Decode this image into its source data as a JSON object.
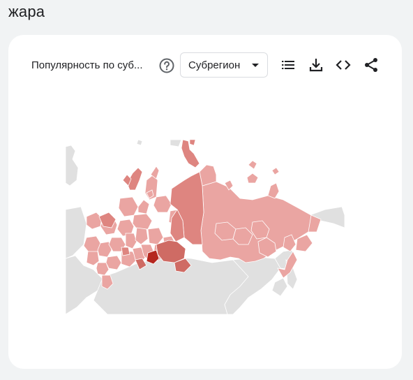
{
  "page": {
    "title": "жара"
  },
  "widget": {
    "title": "Популярность по суб...",
    "resolution_select": {
      "selected": "Субрегион"
    },
    "icons": {
      "help": "help-circle-icon",
      "list": "list-icon",
      "download": "download-icon",
      "embed": "code-embed-icon",
      "share": "share-icon"
    }
  },
  "map": {
    "colors": {
      "no_data": "#e0e0e0",
      "low": "#eaa5a2",
      "medium": "#de8580",
      "high": "#cf6b64",
      "highest": "#b5271f",
      "border": "#ffffff"
    }
  }
}
